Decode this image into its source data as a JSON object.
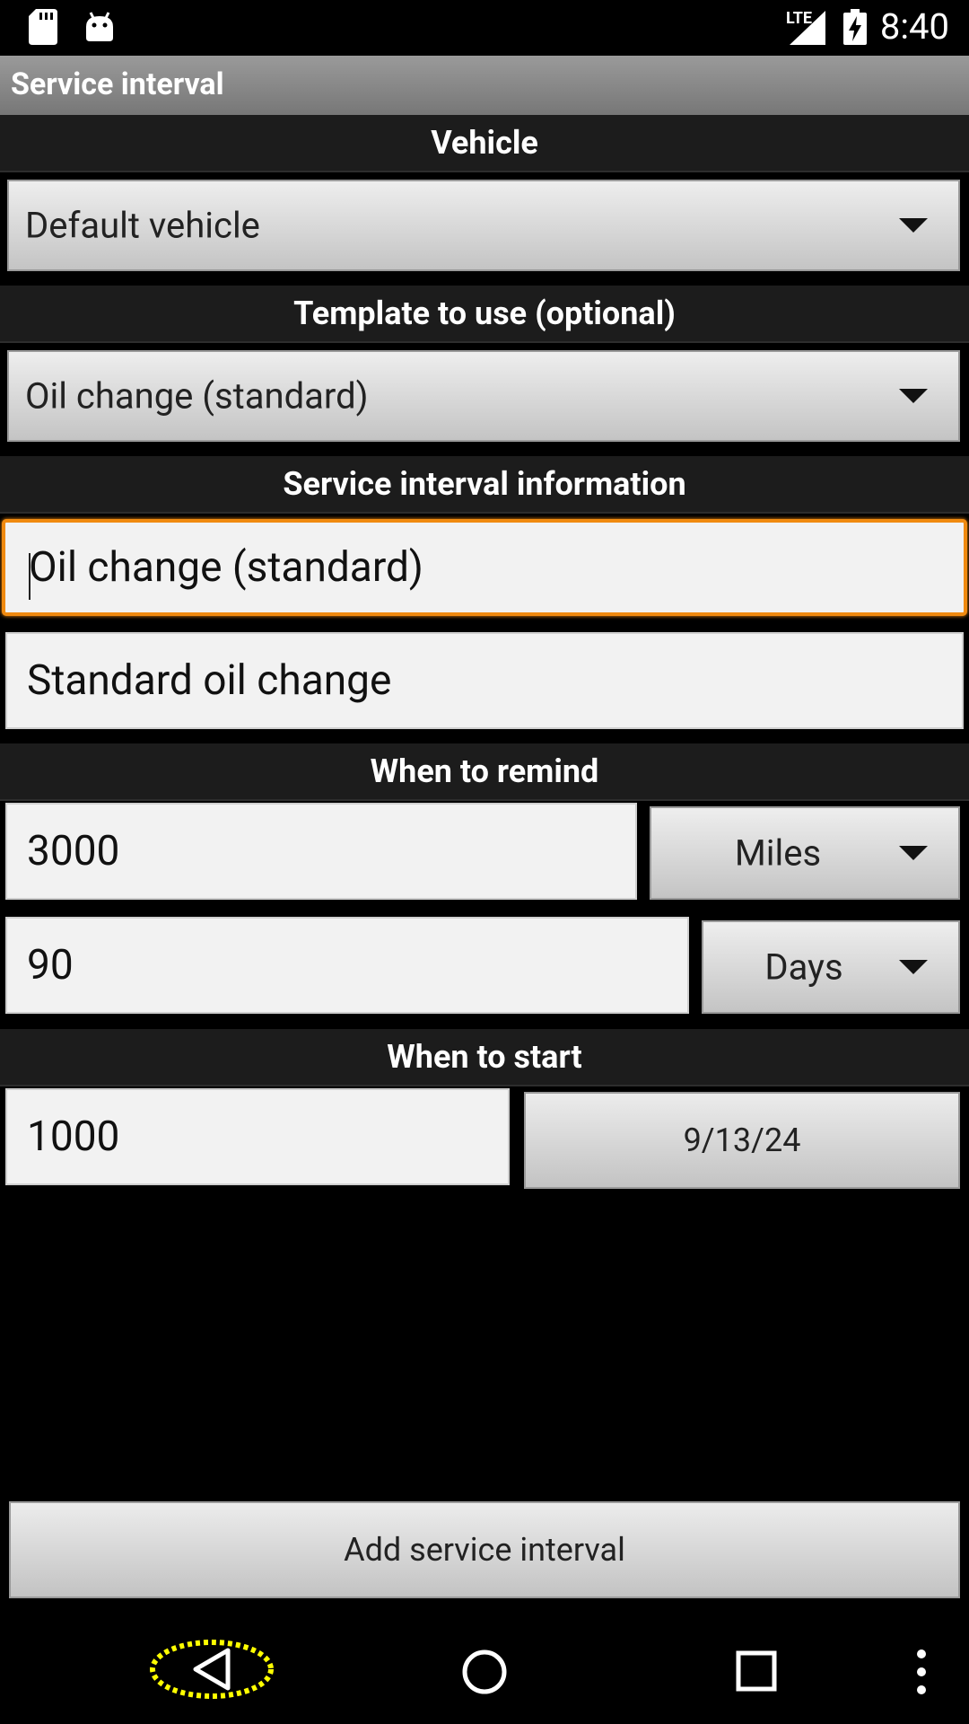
{
  "status_bar": {
    "time": "8:40",
    "network": "LTE",
    "icons": [
      "sd-card-icon",
      "android-icon",
      "signal-icon",
      "battery-charging-icon"
    ]
  },
  "app_bar": {
    "title": "Service interval"
  },
  "vehicle": {
    "header": "Vehicle",
    "selected": "Default vehicle"
  },
  "template": {
    "header": "Template to use (optional)",
    "selected": "Oil change (standard)"
  },
  "info": {
    "header": "Service interval information",
    "name_value": "Oil change (standard)",
    "description_value": "Standard oil change"
  },
  "remind": {
    "header": "When to remind",
    "distance_value": "3000",
    "distance_unit": "Miles",
    "time_value": "90",
    "time_unit": "Days"
  },
  "start": {
    "header": "When to start",
    "odometer_value": "1000",
    "date": "9/13/24"
  },
  "actions": {
    "add_label": "Add service interval"
  },
  "nav": {
    "icons": [
      "back-icon",
      "home-icon",
      "recents-icon",
      "overflow-menu-icon"
    ]
  },
  "colors": {
    "focus": "#f08a10",
    "highlight": "#ffff00"
  }
}
